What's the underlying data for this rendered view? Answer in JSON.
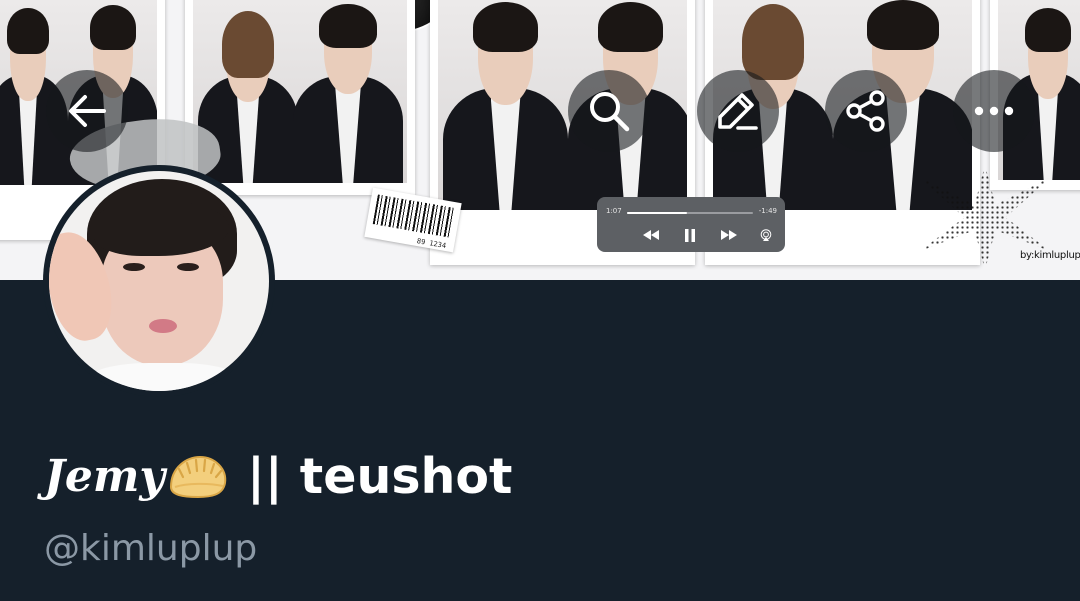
{
  "profile": {
    "display_name_script": "Jemy",
    "display_name_emoji": "dumpling",
    "display_name_rest": "|| teushot",
    "handle": "@kimluplup"
  },
  "banner": {
    "barcode_number": "89 1234",
    "watermark": "by:kimluplup",
    "player": {
      "elapsed": "1:07",
      "remaining": "-1:49",
      "progress_fraction": 0.48
    }
  },
  "header_actions": {
    "back": "arrow-left-icon",
    "search": "search-icon",
    "edit": "pencil-icon",
    "share": "share-icon",
    "more": "more-horizontal-icon"
  },
  "colors": {
    "background": "#15202b",
    "name": "#ffffff",
    "handle": "#8b98a5"
  }
}
